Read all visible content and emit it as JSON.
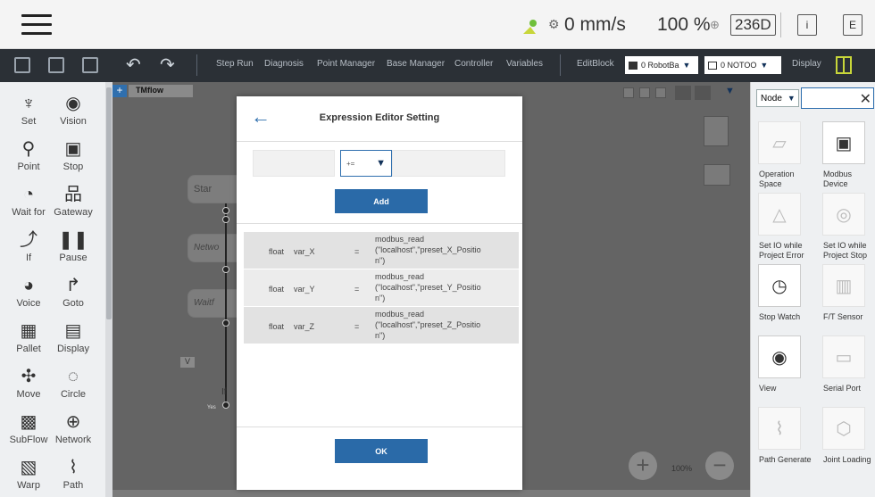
{
  "status": {
    "speed": "0 mm/s",
    "percent": "100 %",
    "badge": "236D",
    "info_icon": "i",
    "log_icon": "E"
  },
  "toolbar": {
    "items": [
      "Step Run",
      "Diagnosis",
      "Point Manager",
      "Base Manager",
      "Controller",
      "Variables"
    ],
    "editblock": "EditBlock",
    "robot_base": "0 RobotBa",
    "tool": "0 NOTOO",
    "display": "Display"
  },
  "palette": {
    "items": [
      {
        "label": "Set",
        "icon": "set-icon",
        "glyph": "♆"
      },
      {
        "label": "Vision",
        "icon": "vision-icon",
        "glyph": "◉"
      },
      {
        "label": "Point",
        "icon": "point-icon",
        "glyph": "⚲"
      },
      {
        "label": "Stop",
        "icon": "stop-icon",
        "glyph": "▣"
      },
      {
        "label": "Wait for",
        "icon": "wait-icon",
        "glyph": "◔"
      },
      {
        "label": "Gateway",
        "icon": "gateway-icon",
        "glyph": "品"
      },
      {
        "label": "If",
        "icon": "if-icon",
        "glyph": "⤴"
      },
      {
        "label": "Pause",
        "icon": "pause-icon",
        "glyph": "❚❚"
      },
      {
        "label": "Voice",
        "icon": "voice-icon",
        "glyph": "◕"
      },
      {
        "label": "Goto",
        "icon": "goto-icon",
        "glyph": "↱"
      },
      {
        "label": "Pallet",
        "icon": "pallet-icon",
        "glyph": "▦"
      },
      {
        "label": "Display",
        "icon": "display-icon",
        "glyph": "▤"
      },
      {
        "label": "Move",
        "icon": "move-icon",
        "glyph": "✣"
      },
      {
        "label": "Circle",
        "icon": "circle-icon",
        "glyph": "◌"
      },
      {
        "label": "SubFlow",
        "icon": "subflow-icon",
        "glyph": "▩"
      },
      {
        "label": "Network",
        "icon": "network-icon",
        "glyph": "⊕"
      },
      {
        "label": "Warp",
        "icon": "warp-icon",
        "glyph": "▧"
      },
      {
        "label": "Path",
        "icon": "path-icon",
        "glyph": "⌇"
      }
    ]
  },
  "canvas": {
    "tab_label": "TMflow",
    "tab_plus": "+",
    "nodes": [
      "Star",
      "Netwo",
      "Waitf"
    ],
    "v_label": "V",
    "if_label": "If",
    "yes_label": "Yes",
    "zoom": "100%"
  },
  "node_panel": {
    "filter": "Node",
    "search_placeholder": "",
    "items": [
      {
        "label": "Operation Space",
        "icon": "operation-space-icon",
        "active": false
      },
      {
        "label": "Modbus Device",
        "icon": "modbus-device-icon",
        "active": true
      },
      {
        "label": "Set IO while Project Error",
        "icon": "io-error-icon",
        "active": false
      },
      {
        "label": "Set IO while Project Stop",
        "icon": "io-stop-icon",
        "active": false
      },
      {
        "label": "Stop Watch",
        "icon": "stopwatch-icon",
        "active": true
      },
      {
        "label": "F/T Sensor",
        "icon": "ft-sensor-icon",
        "active": false
      },
      {
        "label": "View",
        "icon": "view-icon",
        "active": true
      },
      {
        "label": "Serial Port",
        "icon": "serial-port-icon",
        "active": false
      },
      {
        "label": "Path Generate",
        "icon": "path-generate-icon",
        "active": false
      },
      {
        "label": "Joint Loading",
        "icon": "joint-loading-icon",
        "active": false
      }
    ]
  },
  "modal": {
    "title": "Expression Editor Setting",
    "left_value": "",
    "operator": "+=",
    "right_value": "",
    "add_label": "Add",
    "ok_label": "OK",
    "variables": [
      {
        "type": "float",
        "name": "var_X",
        "op": "=",
        "expr": "modbus_read\n(\"localhost\",\"preset_X_Positio\nn\")"
      },
      {
        "type": "float",
        "name": "var_Y",
        "op": "=",
        "expr": "modbus_read\n(\"localhost\",\"preset_Y_Positio\nn\")"
      },
      {
        "type": "float",
        "name": "var_Z",
        "op": "=",
        "expr": "modbus_read\n(\"localhost\",\"preset_Z_Positio\nn\")"
      }
    ]
  },
  "colors": {
    "accent": "#2a6aa8",
    "toolbar_bg": "#2b3036",
    "canvas_bg": "#646464",
    "status_green": "#6fbf3a",
    "robot_yellow": "#c8d63a"
  }
}
